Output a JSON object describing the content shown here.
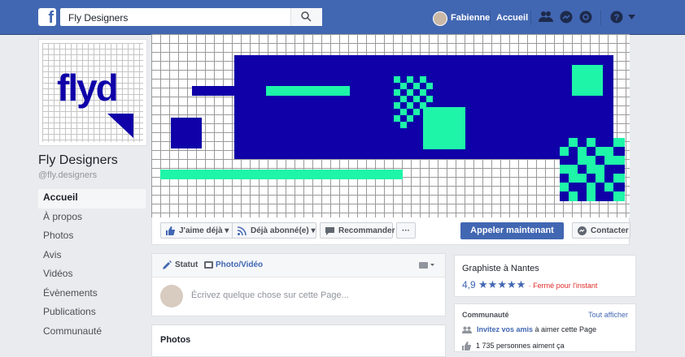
{
  "topbar": {
    "logo_letter": "f",
    "search_value": "Fly Designers",
    "user_name": "Fabienne",
    "home_label": "Accueil"
  },
  "profile": {
    "logo_text": "flyd",
    "page_name": "Fly Designers",
    "handle": "@fly.designers"
  },
  "menu": [
    {
      "label": "Accueil",
      "active": true
    },
    {
      "label": "À propos"
    },
    {
      "label": "Photos"
    },
    {
      "label": "Avis"
    },
    {
      "label": "Vidéos"
    },
    {
      "label": "Évènements"
    },
    {
      "label": "Publications"
    },
    {
      "label": "Communauté"
    }
  ],
  "actions": {
    "like": "J'aime déjà",
    "follow": "Déjà abonné(e)",
    "recommend": "Recommander",
    "more": "···",
    "call": "Appeler maintenant",
    "contact": "Contacter"
  },
  "composer": {
    "tab_status": "Statut",
    "tab_photo": "Photo/Vidéo",
    "placeholder": "Écrivez quelque chose sur cette Page..."
  },
  "photos": {
    "title": "Photos"
  },
  "about": {
    "category": "Graphiste à Nantes",
    "rating": "4,9",
    "stars": "★★★★★",
    "status": "· Fermé pour l'instant"
  },
  "community": {
    "title": "Communauté",
    "see_all": "Tout afficher",
    "invite_link": "Invitez vos amis",
    "invite_rest": " à aimer cette Page",
    "likes": "1 735 personnes aiment ça"
  },
  "colors": {
    "brand_blue": "#4267b2",
    "cover_navy": "#0f00a8",
    "cover_mint": "#1ef5a9"
  }
}
